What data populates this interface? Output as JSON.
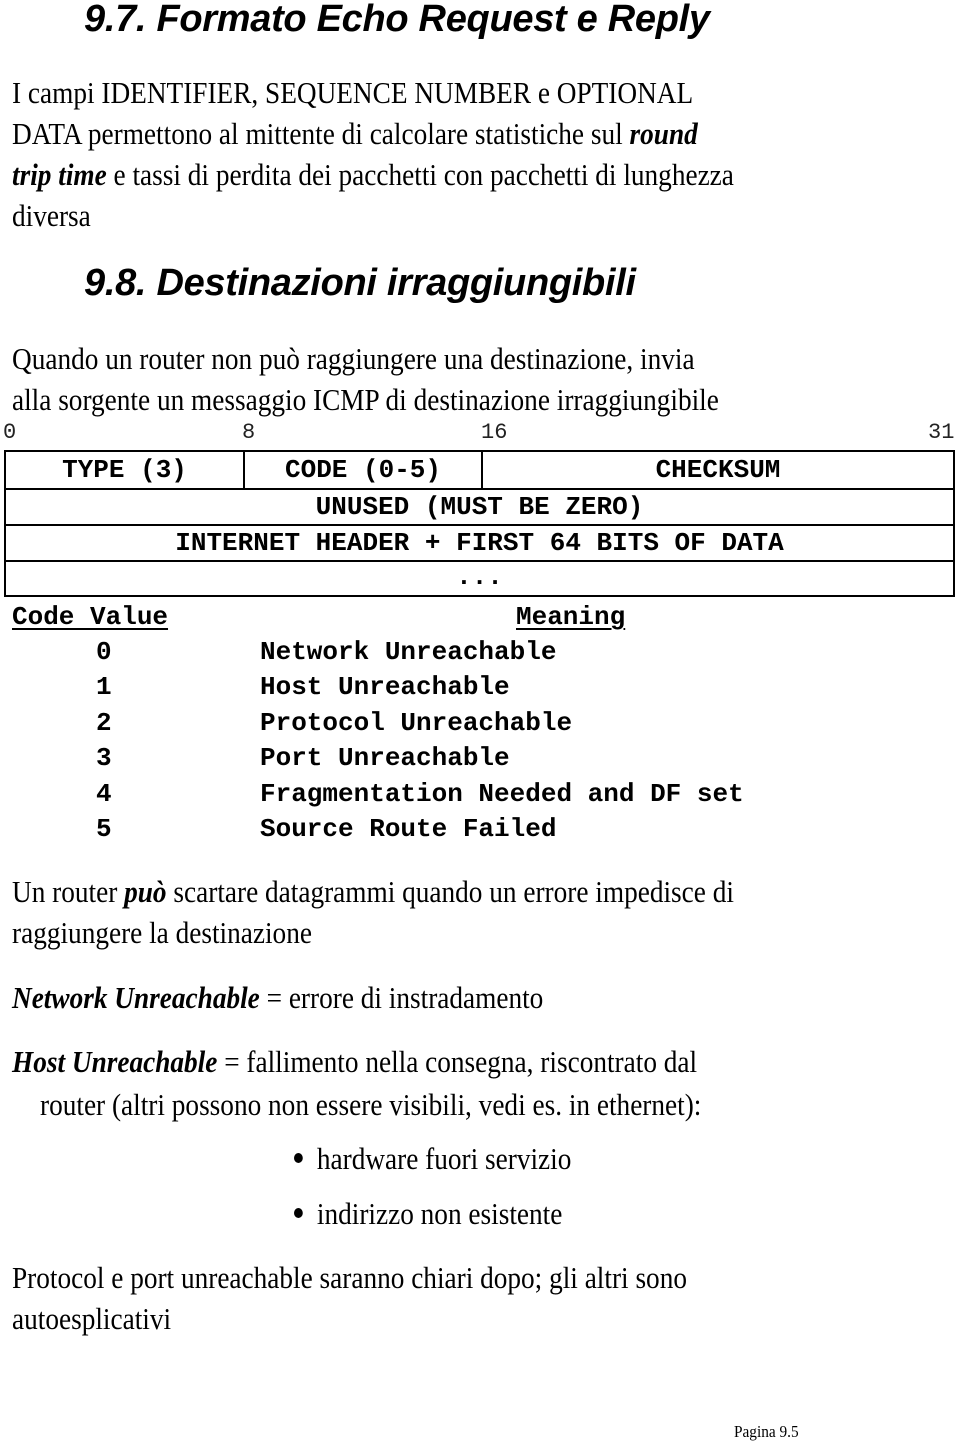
{
  "section_97": {
    "title": "9.7.  Formato Echo Request e Reply",
    "para_lines": [
      [
        "I campi IDENTIFIER, SEQUENCE NUMBER e OPTIONAL"
      ],
      [
        "DATA permettono al mittente di calcolare statistiche sul ",
        "round"
      ],
      [
        "trip time",
        " e tassi di perdita dei pacchetti con pacchetti di lunghezza"
      ],
      [
        "diversa"
      ]
    ]
  },
  "section_98": {
    "title": "9.8.  Destinazioni irraggiungibili",
    "intro_lines": [
      "Quando un router non può raggiungere una destinazione, invia",
      "alla sorgente un messaggio ICMP di destinazione irraggiungibile"
    ]
  },
  "packet_format": {
    "bit_labels": [
      "0",
      "8",
      "16",
      "31"
    ],
    "rows": [
      [
        "TYPE (3)",
        "CODE (0-5)",
        "CHECKSUM"
      ],
      [
        "UNUSED (MUST BE ZERO)"
      ],
      [
        "INTERNET HEADER + FIRST 64 BITS OF DATA"
      ],
      [
        "..."
      ]
    ]
  },
  "code_table": {
    "headers": [
      "Code Value",
      "Meaning"
    ],
    "rows": [
      {
        "code": "0",
        "meaning": "Network Unreachable"
      },
      {
        "code": "1",
        "meaning": "Host Unreachable"
      },
      {
        "code": "2",
        "meaning": "Protocol Unreachable"
      },
      {
        "code": "3",
        "meaning": "Port Unreachable"
      },
      {
        "code": "4",
        "meaning": "Fragmentation Needed and DF set"
      },
      {
        "code": "5",
        "meaning": "Source Route Failed"
      }
    ]
  },
  "discard_para": {
    "line1_pre": "Un router ",
    "line1_emph": "può",
    "line1_post": " scartare datagrammi quando un errore impedisce di",
    "line2": "raggiungere la destinazione"
  },
  "network_def": {
    "term": "Network Unreachable",
    "definition": " = errore di instradamento"
  },
  "host_def": {
    "term": "Host Unreachable",
    "definition": " = fallimento nella consegna, riscontrato dal",
    "continuation": "router (altri possono non essere visibili, vedi es. in ethernet):",
    "bullets": [
      "hardware fuori servizio",
      "indirizzo non esistente"
    ]
  },
  "closing_para": {
    "lines": [
      "Protocol e port unreachable saranno chiari dopo; gli altri sono",
      "autoesplicativi"
    ]
  },
  "footer": {
    "page_label": "Pagina 9.5"
  }
}
